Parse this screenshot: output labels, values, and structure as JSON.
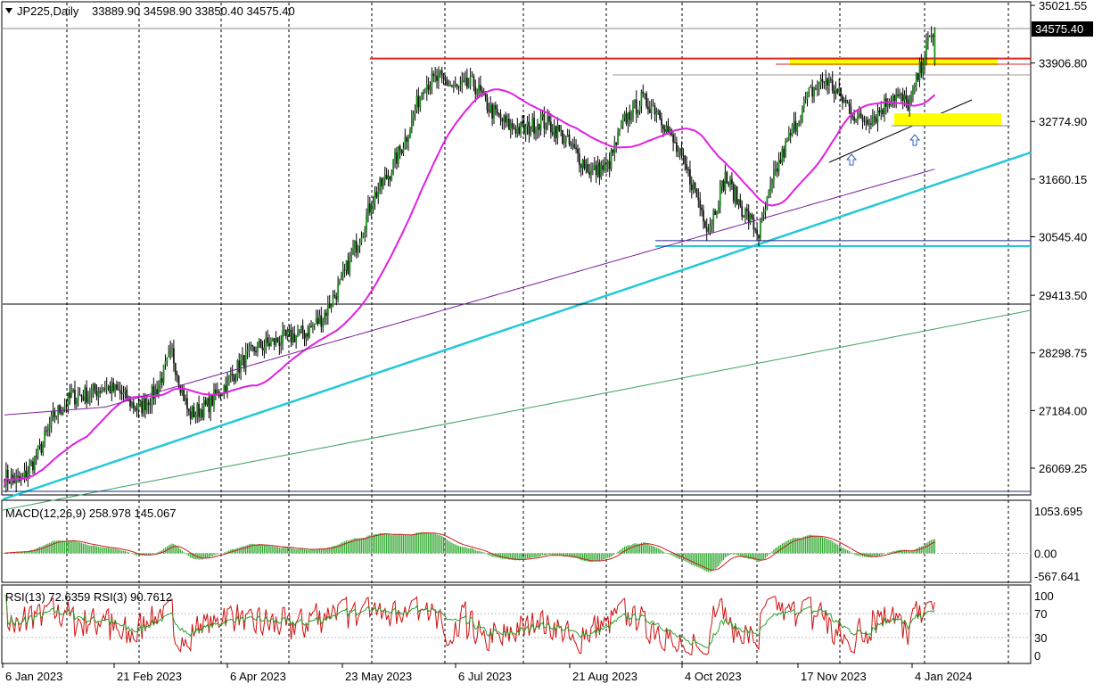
{
  "header": {
    "symbol_label": "JP225,Daily",
    "ohlc": "33889.90 34598.90 33850.40 34575.40",
    "menu_icon": "triangle-down-icon"
  },
  "price_axis": {
    "ticks": [
      "35021.55",
      "33906.80",
      "32774.90",
      "31660.15",
      "30545.40",
      "29413.50",
      "28298.75",
      "27184.00",
      "26069.25"
    ],
    "current_price": "34575.40"
  },
  "macd": {
    "label": "MACD(12,26,9) 258.978 145.067",
    "ticks": [
      "1053.695",
      "0.00",
      "-567.641"
    ]
  },
  "rsi": {
    "label": "RSI(13) 72.6359  RSI(3) 90.7612",
    "ticks": [
      "100",
      "70",
      "30",
      "0"
    ]
  },
  "time_axis": {
    "labels": [
      "6 Jan 2023",
      "21 Feb 2023",
      "6 Apr 2023",
      "23 May 2023",
      "6 Jul 2023",
      "21 Aug 2023",
      "4 Oct 2023",
      "17 Nov 2023",
      "4 Jan 2024"
    ]
  },
  "colors": {
    "bull": "#1a8c1a",
    "bear": "#1a1a1a",
    "ma_fast": "#e020e0",
    "ma_slow": "#7a1a9a",
    "trend_cyan": "#22c8d8",
    "trend_green": "#3aa060",
    "resistance": "#e02020",
    "zone": "#ffff00",
    "support_navy": "#1a2a8a",
    "arrow": "#3060c0",
    "macd_hist": "#2fa82f",
    "macd_signal": "#c81e1e",
    "rsi_fast": "#d01010",
    "rsi_slow": "#2aa02a"
  },
  "chart_data": {
    "type": "candlestick",
    "symbol": "JP225",
    "timeframe": "Daily",
    "last_bar": {
      "open": 33889.9,
      "high": 34598.9,
      "low": 33850.4,
      "close": 34575.4
    },
    "ylim": [
      25500,
      35300
    ],
    "x_labels": [
      "6 Jan 2023",
      "21 Feb 2023",
      "6 Apr 2023",
      "23 May 2023",
      "6 Jul 2023",
      "21 Aug 2023",
      "4 Oct 2023",
      "17 Nov 2023",
      "4 Jan 2024"
    ],
    "close_path": [
      [
        0,
        25900
      ],
      [
        10,
        25800
      ],
      [
        20,
        26350
      ],
      [
        30,
        27100
      ],
      [
        40,
        27450
      ],
      [
        50,
        27500
      ],
      [
        60,
        27650
      ],
      [
        70,
        27500
      ],
      [
        80,
        27200
      ],
      [
        90,
        27550
      ],
      [
        100,
        28300
      ],
      [
        110,
        27100
      ],
      [
        120,
        27250
      ],
      [
        130,
        27600
      ],
      [
        140,
        28050
      ],
      [
        150,
        28400
      ],
      [
        160,
        28500
      ],
      [
        170,
        28600
      ],
      [
        180,
        28700
      ],
      [
        190,
        29000
      ],
      [
        200,
        29600
      ],
      [
        210,
        30400
      ],
      [
        220,
        31300
      ],
      [
        230,
        31800
      ],
      [
        240,
        32500
      ],
      [
        250,
        33500
      ],
      [
        260,
        33600
      ],
      [
        270,
        33400
      ],
      [
        280,
        33500
      ],
      [
        290,
        33000
      ],
      [
        300,
        32700
      ],
      [
        310,
        32600
      ],
      [
        320,
        32800
      ],
      [
        330,
        32600
      ],
      [
        340,
        32200
      ],
      [
        350,
        31800
      ],
      [
        360,
        31900
      ],
      [
        370,
        32800
      ],
      [
        380,
        33200
      ],
      [
        390,
        33000
      ],
      [
        400,
        32300
      ],
      [
        410,
        31600
      ],
      [
        420,
        30700
      ],
      [
        430,
        31700
      ],
      [
        440,
        31100
      ],
      [
        450,
        30600
      ],
      [
        460,
        31800
      ],
      [
        470,
        32600
      ],
      [
        480,
        33300
      ],
      [
        490,
        33600
      ],
      [
        500,
        33200
      ],
      [
        510,
        32800
      ],
      [
        520,
        32900
      ],
      [
        530,
        33300
      ],
      [
        540,
        33100
      ],
      [
        550,
        34200
      ],
      [
        555,
        34575
      ]
    ],
    "resistance_lines": [
      33994,
      33883
    ],
    "support_lines": [
      30470,
      30364
    ],
    "macd": {
      "macd": 258.978,
      "signal": 145.067,
      "ylim": [
        -567.641,
        1053.695
      ]
    },
    "rsi": {
      "rsi13": 72.6359,
      "rsi3": 90.7612,
      "levels": [
        70,
        30
      ],
      "ylim": [
        0,
        100
      ]
    }
  }
}
